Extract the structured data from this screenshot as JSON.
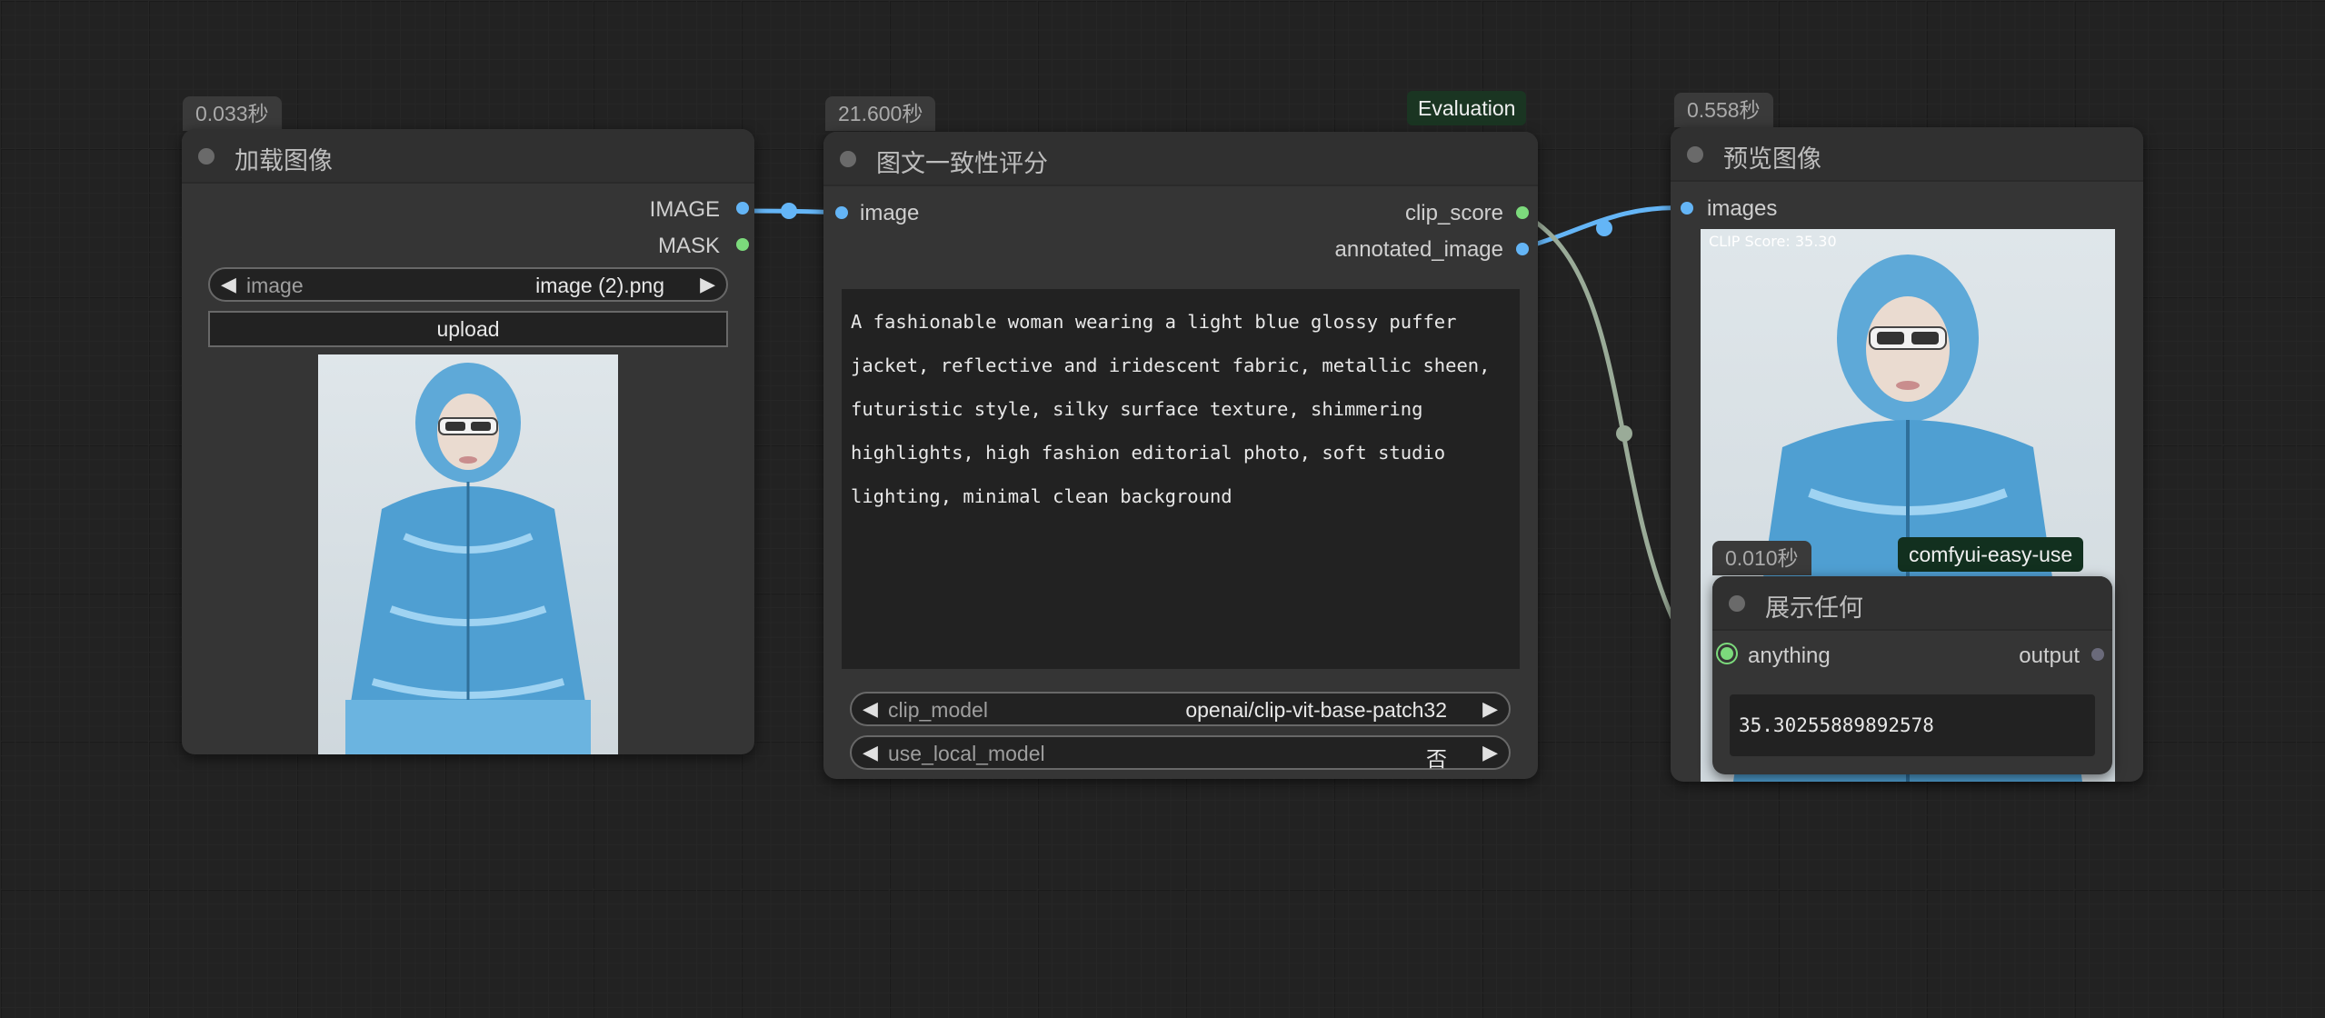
{
  "canvas": {
    "background": "#222222"
  },
  "colors": {
    "image_link": "#64b5f6",
    "float_link": "#9aab98",
    "eval_tag": "#1a3522"
  },
  "load_image_node": {
    "timing": "0.033秒",
    "title": "加载图像",
    "outputs": [
      "IMAGE",
      "MASK"
    ],
    "image_widget": {
      "label": "image",
      "value": "image (2).png"
    },
    "upload_label": "upload",
    "preview": "fashion model in light blue glossy puffer jacket"
  },
  "clip_score_node": {
    "timing": "21.600秒",
    "tag": "Evaluation",
    "title": "图文一致性评分",
    "inputs": [
      "image"
    ],
    "outputs": [
      "clip_score",
      "annotated_image"
    ],
    "prompt_text": "A fashionable woman wearing a light blue glossy puffer jacket, reflective and iridescent fabric, metallic sheen, futuristic style, silky surface texture, shimmering highlights, high fashion editorial photo, soft studio lighting, minimal clean background",
    "clip_model": {
      "label": "clip_model",
      "value": "openai/clip-vit-base-patch32"
    },
    "use_local_model": {
      "label": "use_local_model",
      "value": "否"
    }
  },
  "preview_node": {
    "timing": "0.558秒",
    "title": "预览图像",
    "inputs": [
      "images"
    ],
    "overlay_text": "CLIP Score: 35.30"
  },
  "show_any_node": {
    "timing": "0.010秒",
    "tag": "comfyui-easy-use",
    "title": "展示任何",
    "input": "anything",
    "output": "output",
    "value": "35.30255889892578"
  }
}
